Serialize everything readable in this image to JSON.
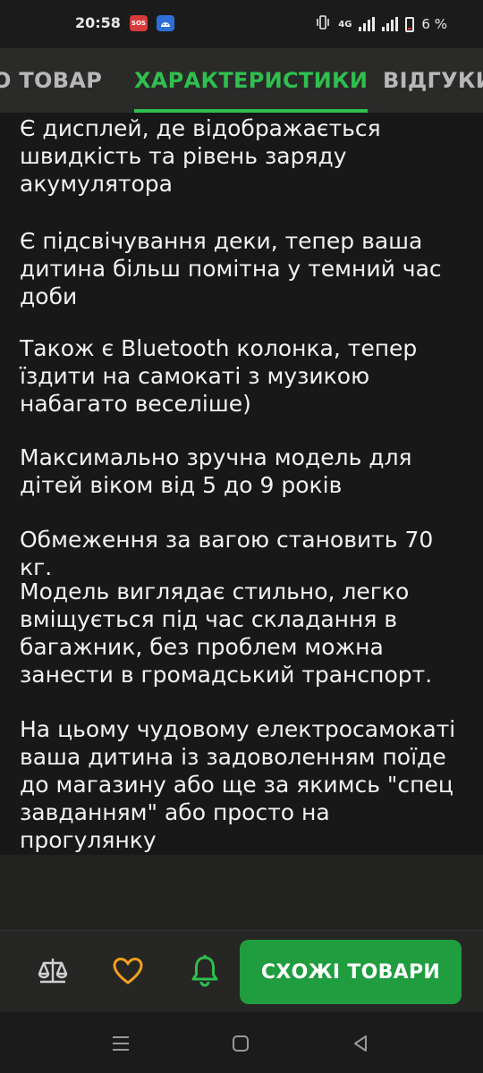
{
  "status_bar": {
    "time": "20:58",
    "sos_badge": "SOS",
    "network": "4G",
    "battery_percent": "6 %",
    "icons": [
      "sos-icon",
      "android-icon",
      "vibrate-icon",
      "signal-icon",
      "battery-icon"
    ]
  },
  "tabs": [
    {
      "label": "О ТОВАР",
      "active": false
    },
    {
      "label": "ХАРАКТЕРИСТИКИ",
      "active": true
    },
    {
      "label": "ВІДГУКИ",
      "active": false
    }
  ],
  "paragraphs": [
    "Є дисплей, де відображається швидкість та рівень заряду акумулятора",
    "Є підсвічування деки, тепер ваша дитина більш помітна у темний час доби",
    "Також є Bluetooth колонка, тепер їздити на самокаті з музикою набагато веселіше)",
    "Максимально зручна модель для дітей віком від 5 до 9 років",
    "Обмеження за вагою становить 70 кг.",
    "Модель виглядає стильно, легко вміщується під час складання в багажник, без проблем можна занести в громадський транспорт.",
    "На цьому чудовому електросамокаті ваша дитина із задоволенням поїде до магазину або ще за якимсь \"спец завданням\" або просто на прогулянку"
  ],
  "bottom_bar": {
    "similar_button": "СХОЖІ ТОВАРИ",
    "icons": [
      "compare-scale-icon",
      "heart-icon",
      "bell-icon"
    ],
    "colors": {
      "accent": "#1f9d3f",
      "heart": "#f2a11e",
      "bell": "#2fbf4f"
    }
  },
  "nav_bar": {
    "icons": [
      "recent-apps-icon",
      "home-icon",
      "back-icon"
    ]
  }
}
